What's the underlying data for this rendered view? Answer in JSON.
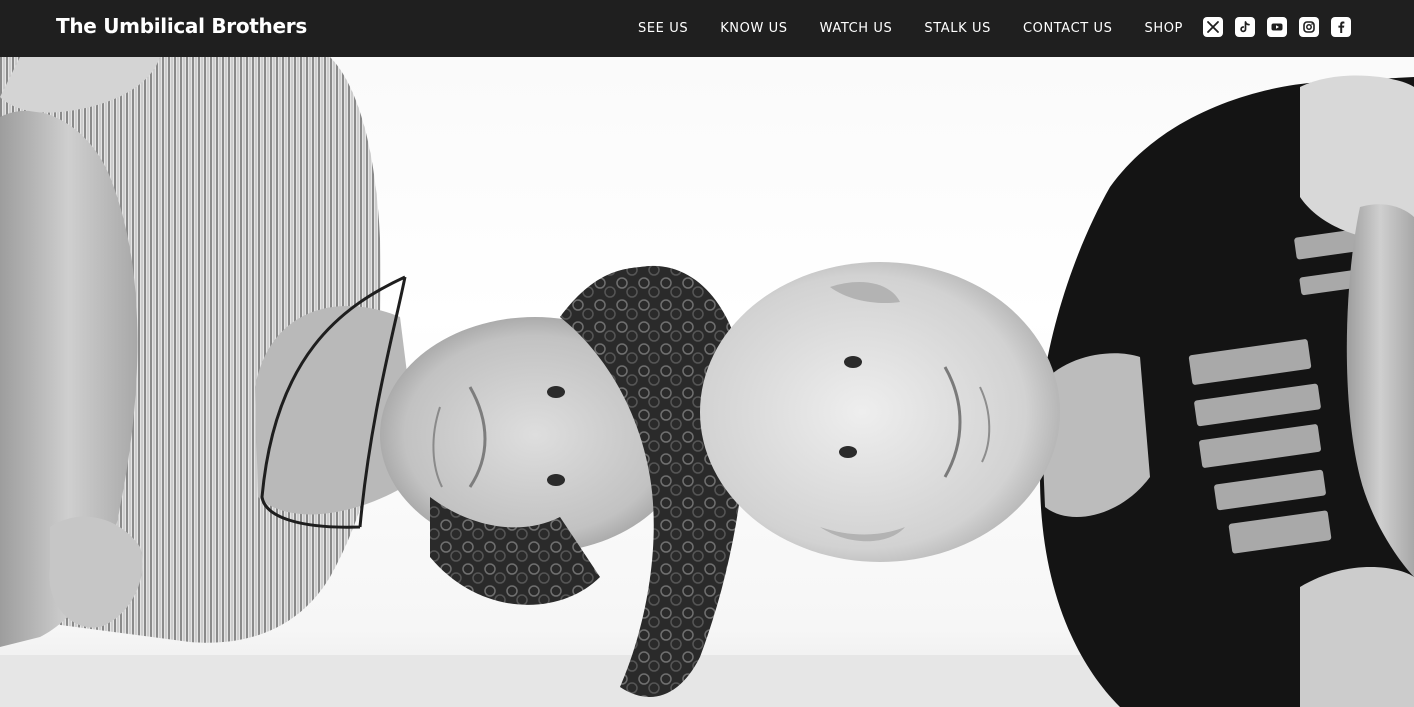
{
  "site": {
    "title": "The Umbilical Brothers"
  },
  "nav": {
    "items": [
      {
        "id": "see-us",
        "label": "SEE US"
      },
      {
        "id": "know-us",
        "label": "KNOW US"
      },
      {
        "id": "watch-us",
        "label": "WATCH US"
      },
      {
        "id": "stalk-us",
        "label": "STALK US"
      },
      {
        "id": "contact-us",
        "label": "CONTACT US"
      },
      {
        "id": "shop",
        "label": "SHOP"
      }
    ]
  },
  "social": {
    "icons": [
      "x-icon",
      "tiktok-icon",
      "youtube-icon",
      "instagram-icon",
      "facebook-icon"
    ]
  },
  "colors": {
    "topbar": "#1f1f1f",
    "nav_text": "#ffffff",
    "hero_background": "#ffffff"
  }
}
